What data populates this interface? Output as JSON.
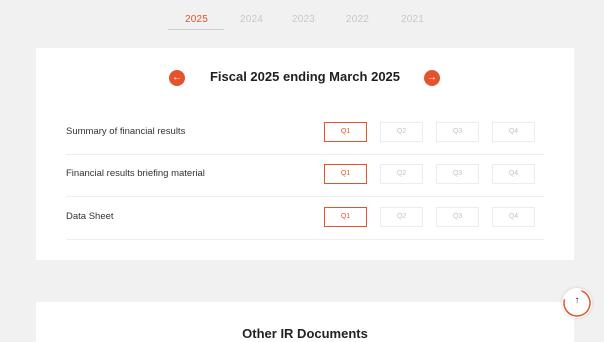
{
  "years": [
    "2025",
    "2024",
    "2023",
    "2022",
    "2021"
  ],
  "selected_year": "2025",
  "fiscal_title": "Fiscal 2025 ending March 2025",
  "nav": {
    "prev_icon": "←",
    "next_icon": "→"
  },
  "quarters": [
    "Q1",
    "Q2",
    "Q3",
    "Q4"
  ],
  "rows": [
    {
      "label": "Summary of financial results",
      "active_quarter": "Q1"
    },
    {
      "label": "Financial results briefing material",
      "active_quarter": "Q1"
    },
    {
      "label": "Data Sheet",
      "active_quarter": "Q1"
    }
  ],
  "next_section_title": "Other IR Documents",
  "scroll_top": {
    "icon": "↑"
  },
  "colors": {
    "accent": "#e5532c",
    "background": "#f1f1f1",
    "card": "#ffffff"
  }
}
